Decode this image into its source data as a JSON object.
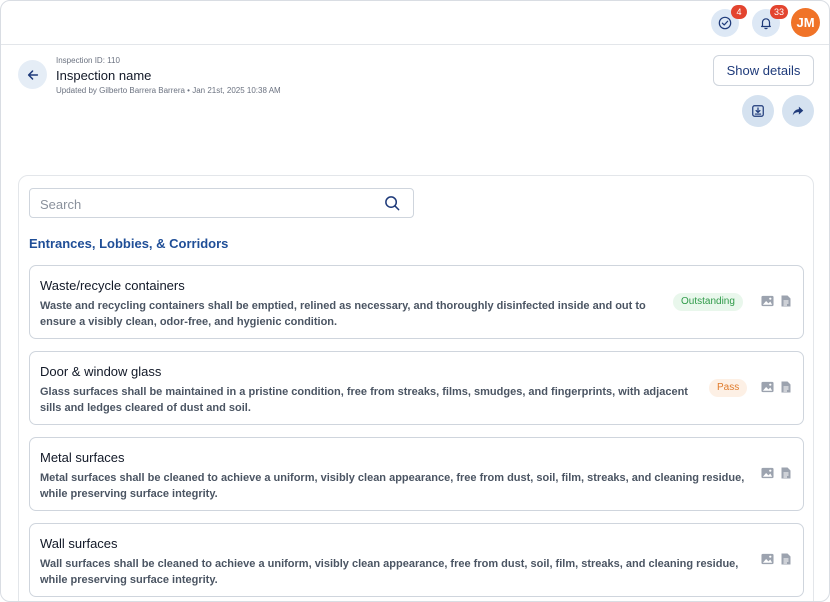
{
  "topbar": {
    "tasks_icon": "check-circle-icon",
    "tasks_badge": "4",
    "notifications_icon": "bell-icon",
    "notifications_badge": "33",
    "avatar_initials": "JM",
    "avatar_color": "#f07328"
  },
  "header": {
    "inspection_id": "Inspection ID: 110",
    "inspection_name": "Inspection name",
    "updated": "Updated by Gilberto Barrera Barrera • Jan 21st, 2025 10:38 AM",
    "show_details_label": "Show details",
    "download_icon": "download-icon",
    "share_icon": "share-icon"
  },
  "search": {
    "placeholder": "Search"
  },
  "section": {
    "title": "Entrances, Lobbies, & Corridors",
    "items": [
      {
        "title": "Waste/recycle containers",
        "description_line1": "Waste and recycling containers shall be emptied, relined as necessary, and thoroughly disinfected inside and out to",
        "description_line2": "ensure a visibly clean, odor-free, and hygienic condition.",
        "status": "Outstanding"
      },
      {
        "title": "Door & window glass",
        "description_line1": "Glass surfaces shall be maintained in a pristine condition, free from streaks, films, smudges, and fingerprints, with adjacent",
        "description_line2": "sills and ledges cleared of dust and soil.",
        "status": "Pass"
      },
      {
        "title": "Metal surfaces",
        "description_line1": "Metal surfaces shall be cleaned to achieve a uniform, visibly clean appearance, free from dust, soil, film, streaks, and cleaning residue,",
        "description_line2": "while preserving surface integrity.",
        "status": ""
      },
      {
        "title": "Wall surfaces",
        "description_line1": "Wall surfaces shall be cleaned to achieve a uniform, visibly clean appearance, free from dust, soil, film, streaks, and cleaning residue,",
        "description_line2": "while preserving surface integrity.",
        "status": ""
      }
    ]
  },
  "colors": {
    "accent": "#1f4e97",
    "badge": "#e3442f",
    "outstanding": "#2f9a49",
    "pass": "#e07b2b"
  }
}
